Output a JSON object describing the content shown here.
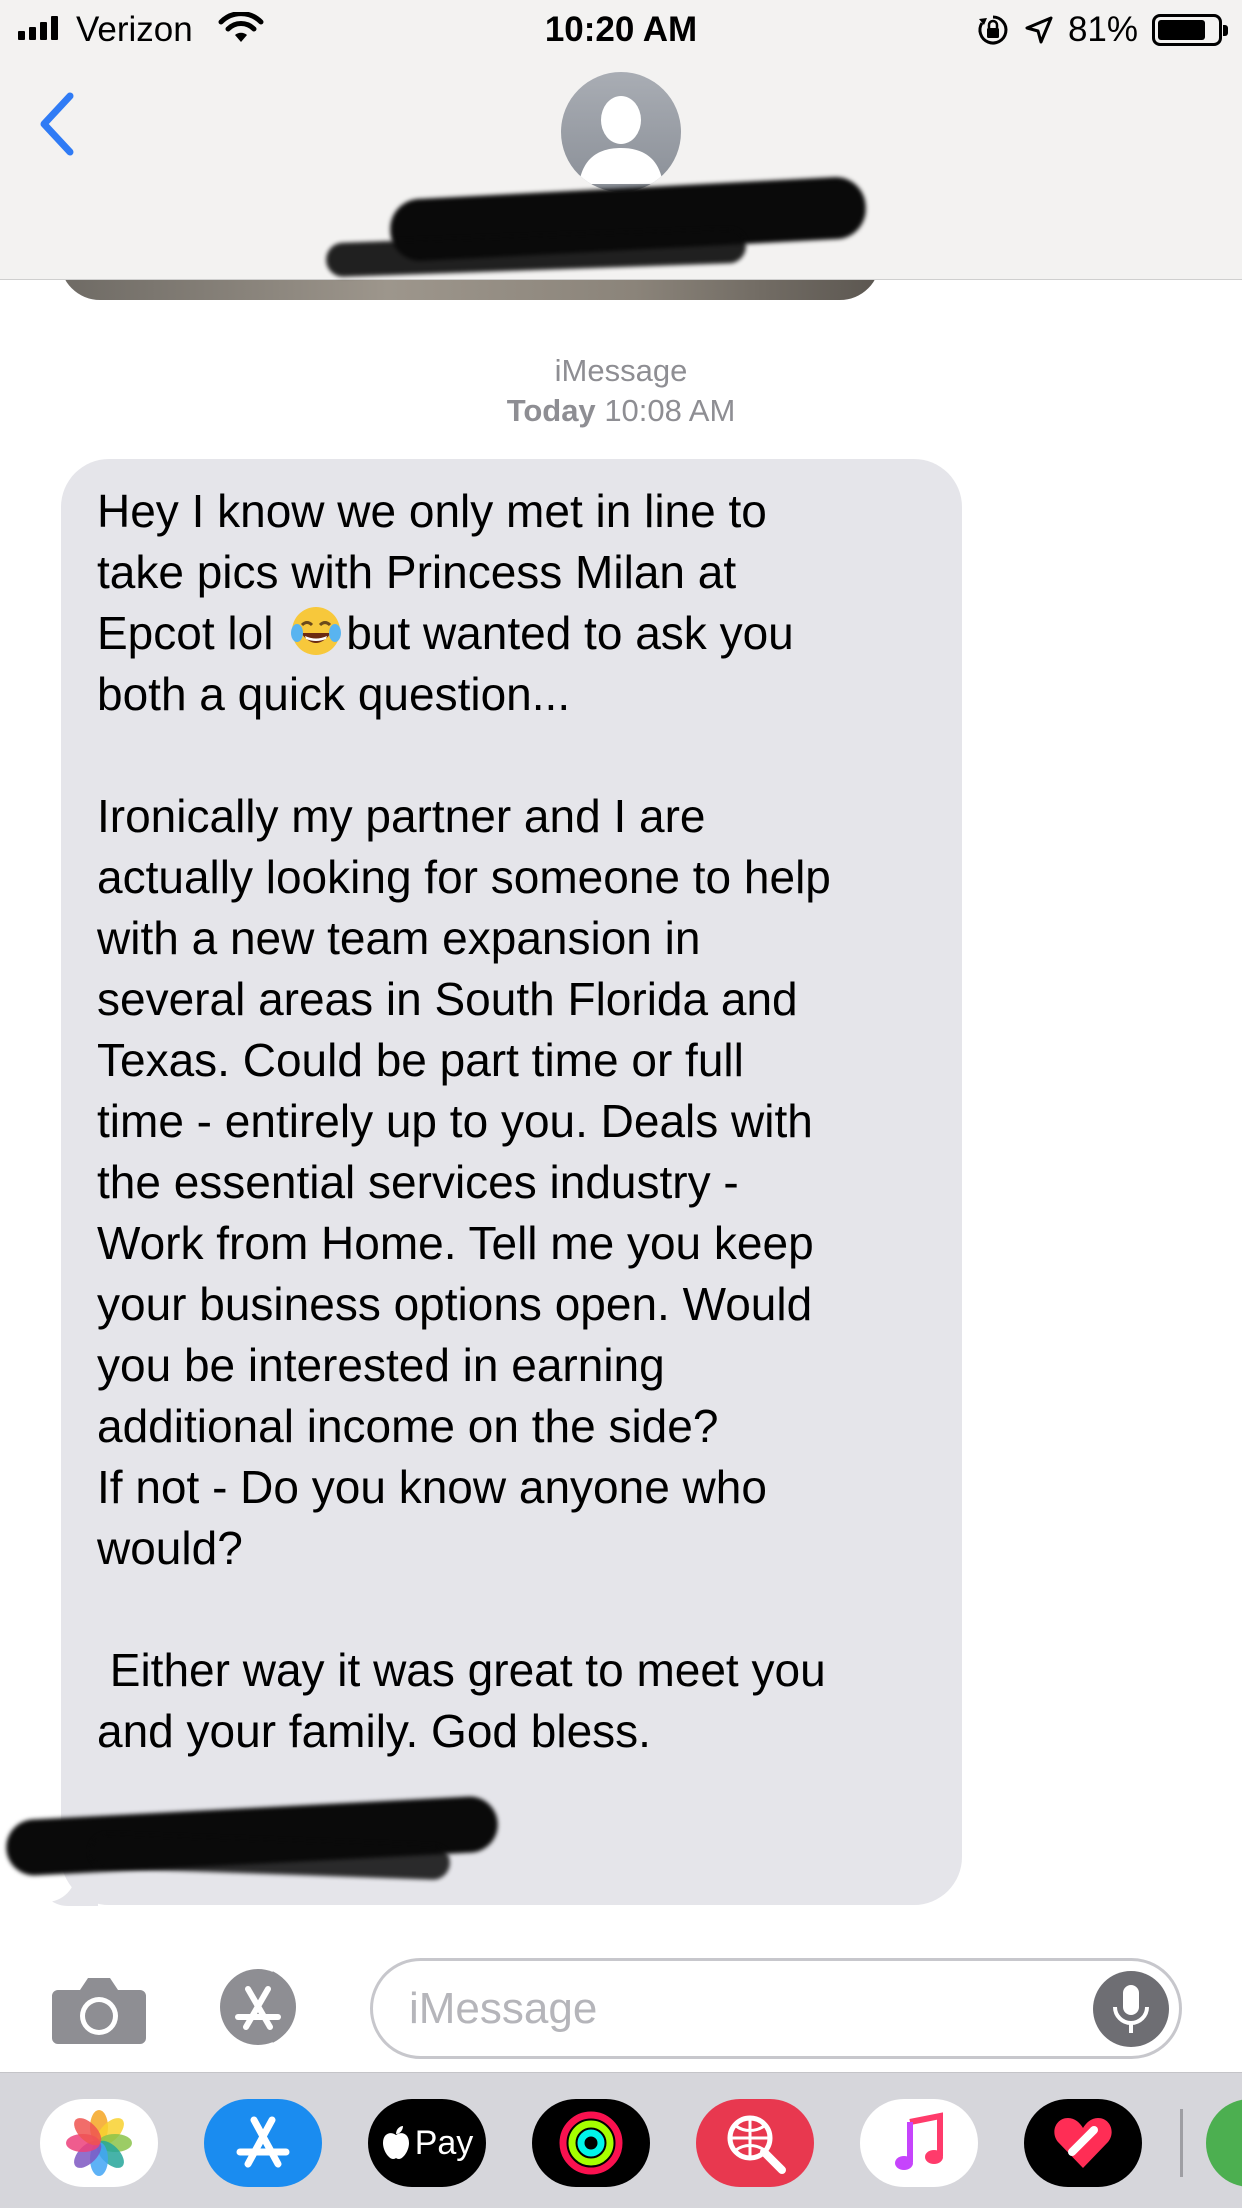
{
  "status_bar": {
    "carrier": "Verizon",
    "time": "10:20 AM",
    "battery_percent": "81%",
    "battery_level": 0.81,
    "signal_bars": 4
  },
  "header": {
    "back_icon": "chevron-left-icon",
    "avatar_icon": "person-silhouette-icon",
    "contact_name_redacted": true
  },
  "conversation": {
    "service_label": "iMessage",
    "day": "Today",
    "time": "10:08 AM",
    "message_lines": [
      "Hey I know we only met in line to",
      "take pics with Princess Milan at",
      "Epcot lol |EMOJI|but wanted to ask you",
      "both a quick question...",
      "",
      "Ironically my partner and I are",
      "actually looking for someone to help",
      "with a new team expansion in",
      "several areas in South Florida and",
      "Texas. Could be part time or full",
      "time - entirely up to you. Deals with",
      "the essential services industry -",
      "Work from Home. Tell me you keep",
      "your business options open. Would",
      "you be interested in earning",
      "additional income on the side?",
      "If not - Do you know anyone who",
      "would?",
      "",
      " Either way it was great to meet you",
      "and your family. God bless.",
      "",
      "- [redacted signature]"
    ],
    "emoji": "face-with-tears-of-joy-emoji",
    "bubble_color": "#e5e5ea"
  },
  "compose": {
    "placeholder": "iMessage",
    "camera_icon": "camera-icon",
    "apps_icon": "app-store-icon",
    "mic_icon": "microphone-icon"
  },
  "app_drawer": {
    "items": [
      {
        "name": "photos-app-icon",
        "bg": "#ffffff"
      },
      {
        "name": "app-store-app-icon",
        "bg": "#1a8cf0"
      },
      {
        "name": "apple-pay-app-icon",
        "bg": "#000000",
        "label": "Pay"
      },
      {
        "name": "activity-app-icon",
        "bg": "#000000"
      },
      {
        "name": "images-search-app-icon",
        "bg": "#e8384f"
      },
      {
        "name": "music-app-icon",
        "bg": "#ffffff"
      },
      {
        "name": "digital-touch-app-icon",
        "bg": "#000000"
      },
      {
        "name": "partial-app-icon",
        "bg": "#4caf50"
      }
    ]
  },
  "colors": {
    "accent": "#2f7bf5",
    "secondary_text": "#8e8e93"
  }
}
